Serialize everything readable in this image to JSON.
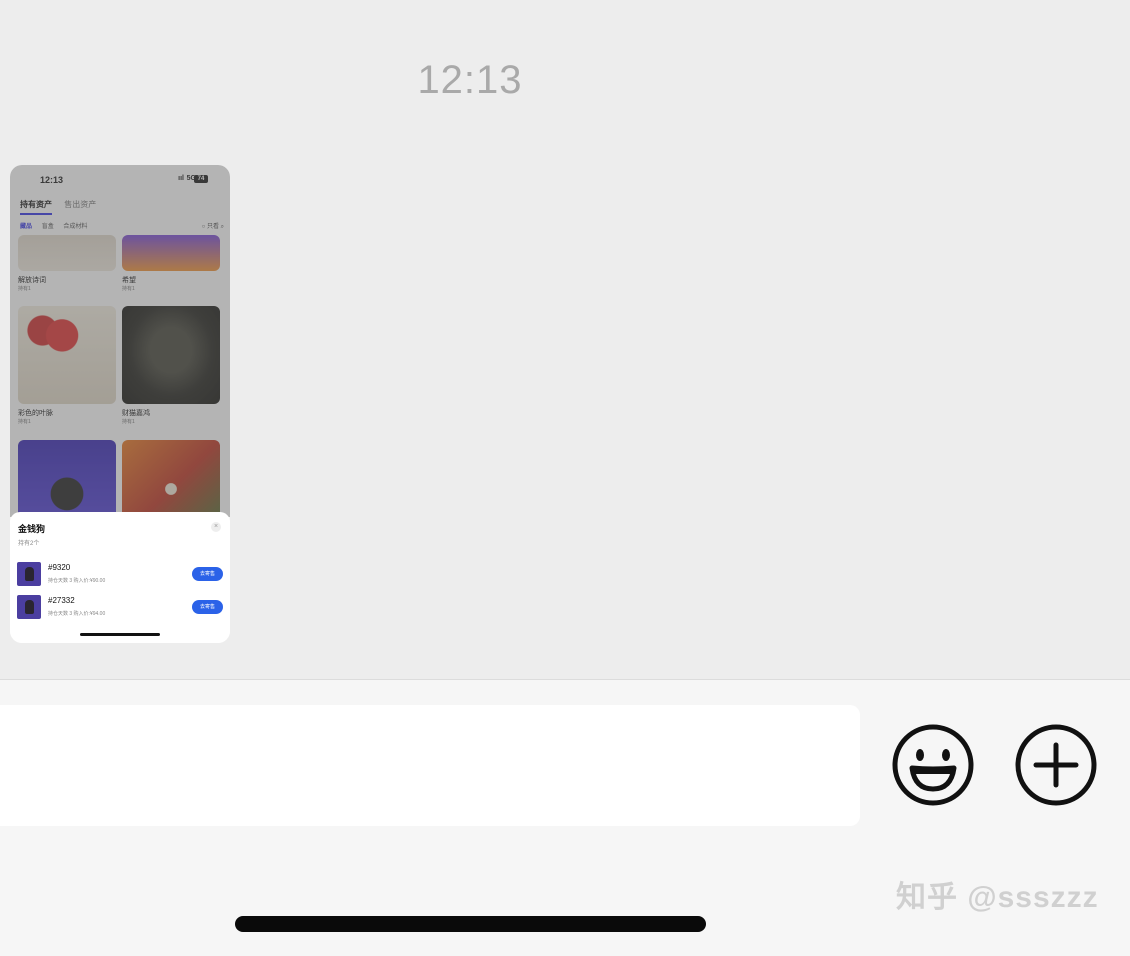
{
  "chat": {
    "timestamp": "12:13"
  },
  "phone": {
    "time": "12:13",
    "signal": "ııl",
    "network": "5G",
    "battery": "74",
    "tabs": [
      {
        "label": "持有资产",
        "active": true
      },
      {
        "label": "售出资产",
        "active": false
      }
    ],
    "filters": {
      "chips": [
        "藏品",
        "盲盒",
        "合成材料"
      ],
      "right_label": "只看"
    },
    "grid": [
      {
        "title": "解放诗词",
        "sub": "持有1"
      },
      {
        "title": "希望",
        "sub": "持有1"
      },
      {
        "title": "彩色的叶脉",
        "sub": "持有1"
      },
      {
        "title": "财猫嘉鸿",
        "sub": "持有1"
      },
      {
        "title": "",
        "sub": ""
      },
      {
        "title": "",
        "sub": ""
      }
    ],
    "sheet": {
      "title": "金钱狗",
      "subtitle": "持有2个",
      "close": "×",
      "rows": [
        {
          "id": "#9320",
          "meta": "持仓天数 3  购入价:¥90.00",
          "button": "去寄售"
        },
        {
          "id": "#27332",
          "meta": "持仓天数 3  购入价:¥94.00",
          "button": "去寄售"
        }
      ]
    }
  },
  "input_bar": {
    "emoji_icon": "smiley-face-icon",
    "plus_icon": "plus-circle-icon"
  },
  "watermark": "知乎 @ssszzz"
}
